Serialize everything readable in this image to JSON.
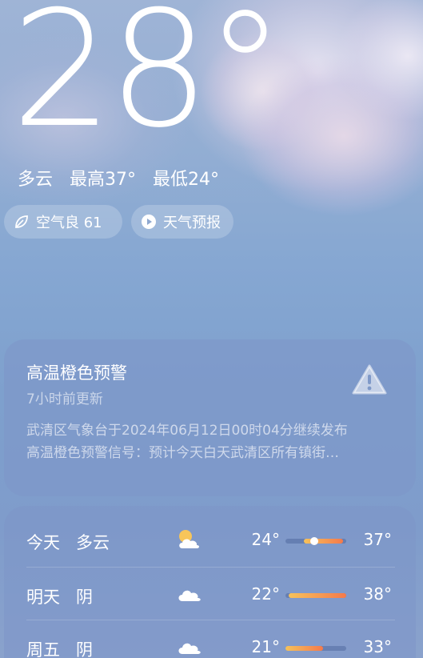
{
  "current": {
    "temperature": "28°",
    "condition": "多云",
    "high": "最高37°",
    "low": "最低24°"
  },
  "chips": {
    "air_quality": "空气良 61",
    "forecast": "天气预报"
  },
  "alert": {
    "title": "高温橙色预警",
    "updated": "7小时前更新",
    "line1": "武清区气象台于2024年06月12日00时04分继续发布",
    "line2": "高温橙色预警信号：预计今天白天武清区所有镇街…"
  },
  "forecast": [
    {
      "day": "今天",
      "condition": "多云",
      "icon": "partly-cloudy-icon",
      "low": "24°",
      "high": "37°",
      "range": [
        0.3,
        0.95
      ],
      "current": 0.48
    },
    {
      "day": "明天",
      "condition": "阴",
      "icon": "cloud-icon",
      "low": "22°",
      "high": "38°",
      "range": [
        0.05,
        1.0
      ]
    },
    {
      "day": "周五",
      "condition": "阴",
      "icon": "cloud-icon",
      "low": "21°",
      "high": "33°",
      "range": [
        0.0,
        0.62
      ]
    }
  ],
  "colors": {
    "bar_start": "#f6c25b",
    "bar_end": "#f57a4b",
    "warning_icon": "#ffffff"
  }
}
